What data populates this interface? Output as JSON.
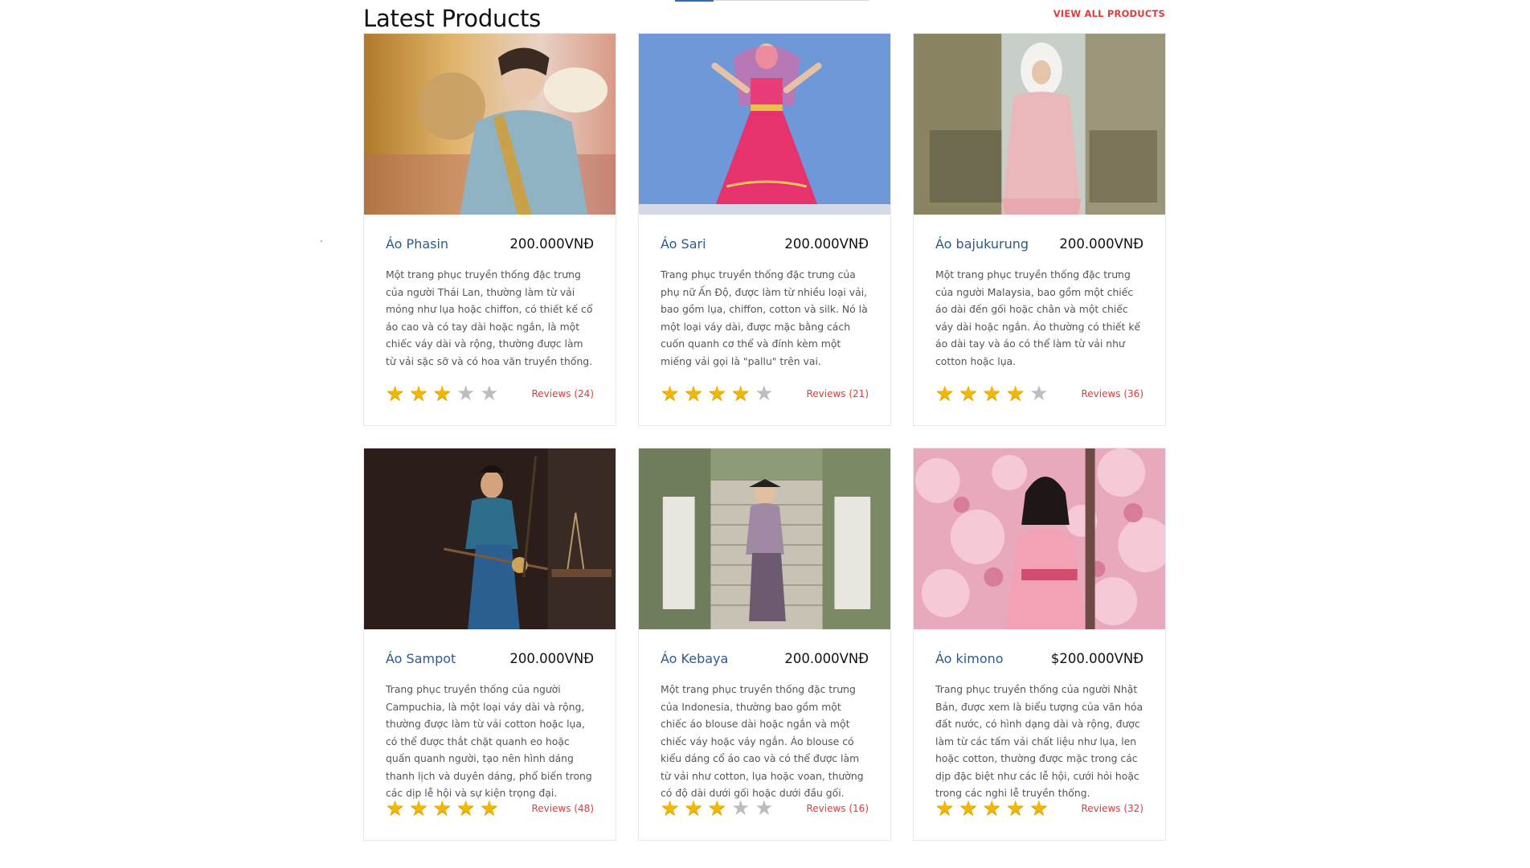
{
  "section": {
    "title": "Latest Products",
    "view_all": "VIEW ALL PRODUCTS"
  },
  "products": [
    {
      "name": "Áo Phasin",
      "price": "200.000VNĐ",
      "description": "Một trang phục truyền thống đặc trưng của người Thái Lan, thường làm từ vải mỏng như lụa hoặc chiffon, có thiết kế cổ áo cao và có tay dài hoặc ngắn, là một chiếc váy dài và rộng, thường được làm từ vải sặc sỡ và có hoa văn truyền thống.",
      "rating": 3,
      "reviews": "Reviews (24)"
    },
    {
      "name": "Áo Sari",
      "price": "200.000VNĐ",
      "description": "Trang phục truyền thống đặc trưng của phụ nữ Ấn Độ, được làm từ nhiều loại vải, bao gồm lụa, chiffon, cotton và silk. Nó là một loại váy dài, được mặc bằng cách cuốn quanh cơ thể và đính kèm một miếng vải gọi là \"pallu\" trên vai.",
      "rating": 4,
      "reviews": "Reviews (21)"
    },
    {
      "name": "Áo bajukurung",
      "price": "200.000VNĐ",
      "description": "Một trang phục truyền thống đặc trưng của người Malaysia, bao gồm một chiếc áo dài đến gối hoặc chân và một chiếc váy dài hoặc ngắn. Áo thường có thiết kế áo dài tay và áo có thể làm từ vải như cotton hoặc lụa.",
      "rating": 4,
      "reviews": "Reviews (36)"
    },
    {
      "name": "Áo Sampot",
      "price": "200.000VNĐ",
      "description": "Trang phục truyền thống của người Campuchia, là một loại váy dài và rộng, thường được làm từ vải cotton hoặc lụa, có thể được thắt chặt quanh eo hoặc quấn quanh người, tạo nên hình dáng thanh lịch và duyên dáng, phổ biến trong các dịp lễ hội và sự kiện trọng đại.",
      "rating": 5,
      "reviews": "Reviews (48)"
    },
    {
      "name": "Áo Kebaya",
      "price": "200.000VNĐ",
      "description": "Một trang phục truyền thống đặc trưng của Indonesia, thường bao gồm một chiếc áo blouse dài hoặc ngắn và một chiếc váy hoặc váy ngắn. Áo blouse có kiểu dáng cổ áo cao và có thể được làm từ vải như cotton, lụa hoặc voan, thường có độ dài dưới gối hoặc dưới đầu gối.",
      "rating": 3,
      "reviews": "Reviews (16)"
    },
    {
      "name": "Áo kimono",
      "price": "$200.000VNĐ",
      "description": "Trang phục truyền thống của người Nhật Bản, được xem là biểu tượng của văn hóa đất nước, có hình dạng dài và rộng, được làm từ các tấm vải chất liệu như lụa, len hoặc cotton, thường được mặc trong các dịp đặc biệt như các lễ hội, cưới hỏi hoặc trong các nghi lễ truyền thống.",
      "rating": 5,
      "reviews": "Reviews (32)"
    }
  ]
}
